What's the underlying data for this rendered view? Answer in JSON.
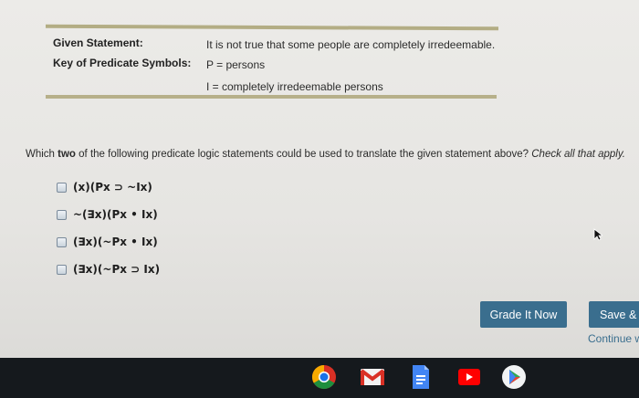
{
  "given": {
    "statement_label": "Given Statement:",
    "statement_text": "It is not true that some people are completely irredeemable.",
    "symbols_label": "Key of Predicate Symbols:",
    "symbol_p": "P = persons",
    "symbol_i": "I = completely irredeemable persons"
  },
  "question": {
    "prefix": "Which ",
    "bold": "two",
    "middle": " of the following predicate logic statements could be used to translate the given statement above? ",
    "italic": "Check all that apply."
  },
  "options": [
    {
      "label": "(x)(Px ⊃ ~Ix)",
      "checked": false
    },
    {
      "label": "~(∃x)(Px • Ix)",
      "checked": false
    },
    {
      "label": "(∃x)(~Px • Ix)",
      "checked": false
    },
    {
      "label": "(∃x)(~Px ⊃ Ix)",
      "checked": false
    }
  ],
  "buttons": {
    "grade": "Grade It Now",
    "save": "Save & C",
    "continue": "Continue w"
  },
  "taskbar": {
    "apps": [
      "chrome-icon",
      "gmail-icon",
      "docs-icon",
      "youtube-icon",
      "play-store-icon"
    ]
  },
  "colors": {
    "accent": "#3a6e8e",
    "rule": "#b3ad84",
    "taskbar": "#15191d"
  }
}
